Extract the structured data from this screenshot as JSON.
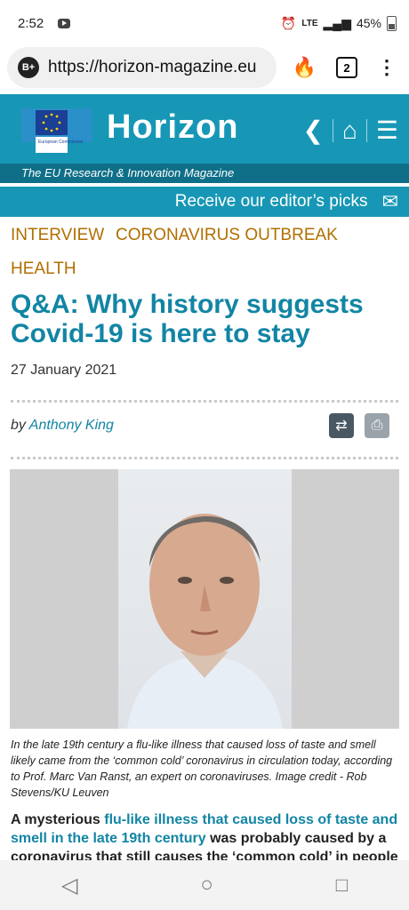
{
  "status": {
    "time": "2:52",
    "network": "LTE",
    "battery": "45%"
  },
  "browser": {
    "url": "https://horizon-magazine.eu",
    "tab_count": "2",
    "badge": "B+"
  },
  "site": {
    "brand": "Horizon",
    "tagline": "The EU Research & Innovation Magazine",
    "flag_text": "European Commission",
    "picks_label": "Receive our editor’s picks"
  },
  "article": {
    "categories": [
      "INTERVIEW",
      "CORONAVIRUS OUTBREAK",
      "HEALTH"
    ],
    "title": "Q&A: Why history suggests Covid-19 is here to stay",
    "date": "27 January 2021",
    "by": "by",
    "author": "Anthony King",
    "caption": "In the late 19th century a flu-like illness that caused loss of taste and smell likely came from the ‘common cold’ coronavirus in circulation today, according to Prof. Marc Van Ranst, an expert on coronaviruses. Image credit - Rob Stevens/KU Leuven",
    "lead_pre": "A mysterious",
    "lead_link": "flu-like illness that caused loss of taste and smell in the late 19th century",
    "lead_post": "was probably caused by a coronavirus that still causes the ‘common cold’ in people"
  },
  "colors": {
    "accent": "#1797b5",
    "category": "#b06f00",
    "title": "#1285a4"
  },
  "icons": [
    "youtube-icon",
    "alarm-icon",
    "signal-icon",
    "battery-icon",
    "flame-icon",
    "tabs-icon",
    "menu-dots-icon",
    "back-chevron-icon",
    "home-icon",
    "list-menu-icon",
    "mail-icon",
    "share-icon",
    "print-icon"
  ]
}
